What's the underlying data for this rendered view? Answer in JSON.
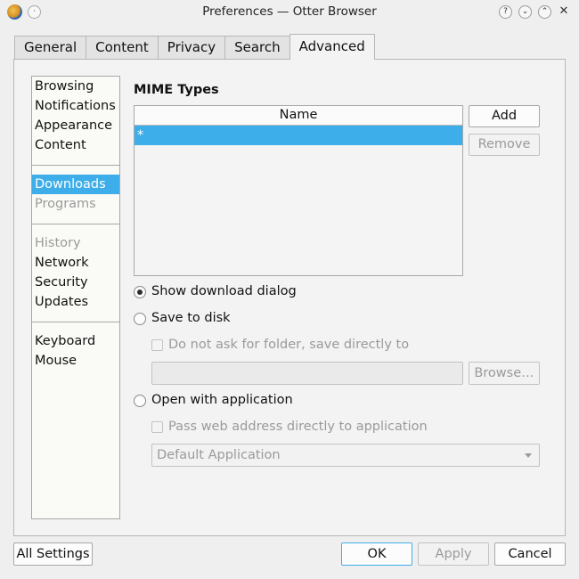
{
  "window": {
    "title": "Preferences — Otter Browser",
    "controls": {
      "help": "?",
      "minimize": "⌄",
      "maximize": "⌃",
      "close": "✕",
      "menu": "·"
    }
  },
  "tabs": [
    {
      "label": "General"
    },
    {
      "label": "Content"
    },
    {
      "label": "Privacy"
    },
    {
      "label": "Search"
    },
    {
      "label": "Advanced",
      "active": true
    }
  ],
  "categories": [
    {
      "label": "Browsing",
      "state": "normal"
    },
    {
      "label": "Notifications",
      "state": "normal"
    },
    {
      "label": "Appearance",
      "state": "normal"
    },
    {
      "label": "Content",
      "state": "normal"
    },
    {
      "label": "Downloads",
      "state": "selected"
    },
    {
      "label": "Programs",
      "state": "disabled"
    },
    {
      "label": "History",
      "state": "disabled"
    },
    {
      "label": "Network",
      "state": "normal"
    },
    {
      "label": "Security",
      "state": "normal"
    },
    {
      "label": "Updates",
      "state": "normal"
    },
    {
      "label": "Keyboard",
      "state": "normal"
    },
    {
      "label": "Mouse",
      "state": "normal"
    }
  ],
  "mime": {
    "heading": "MIME Types",
    "column_header": "Name",
    "rows": [
      "*"
    ],
    "add_label": "Add",
    "remove_label": "Remove"
  },
  "options": {
    "show_dialog": {
      "label": "Show download dialog",
      "checked": true
    },
    "save_to_disk": {
      "label": "Save to disk",
      "checked": false
    },
    "no_ask_folder": {
      "label": "Do not ask for folder, save directly to",
      "checked": false
    },
    "folder_path": "",
    "browse_label": "Browse…",
    "open_with_app": {
      "label": "Open with application",
      "checked": false
    },
    "pass_address": {
      "label": "Pass web address directly to application",
      "checked": false
    },
    "application_select": "Default Application"
  },
  "footer": {
    "all_settings": "All Settings",
    "ok": "OK",
    "apply": "Apply",
    "cancel": "Cancel"
  },
  "colors": {
    "accent": "#3daee9",
    "window_bg": "#efefef"
  }
}
